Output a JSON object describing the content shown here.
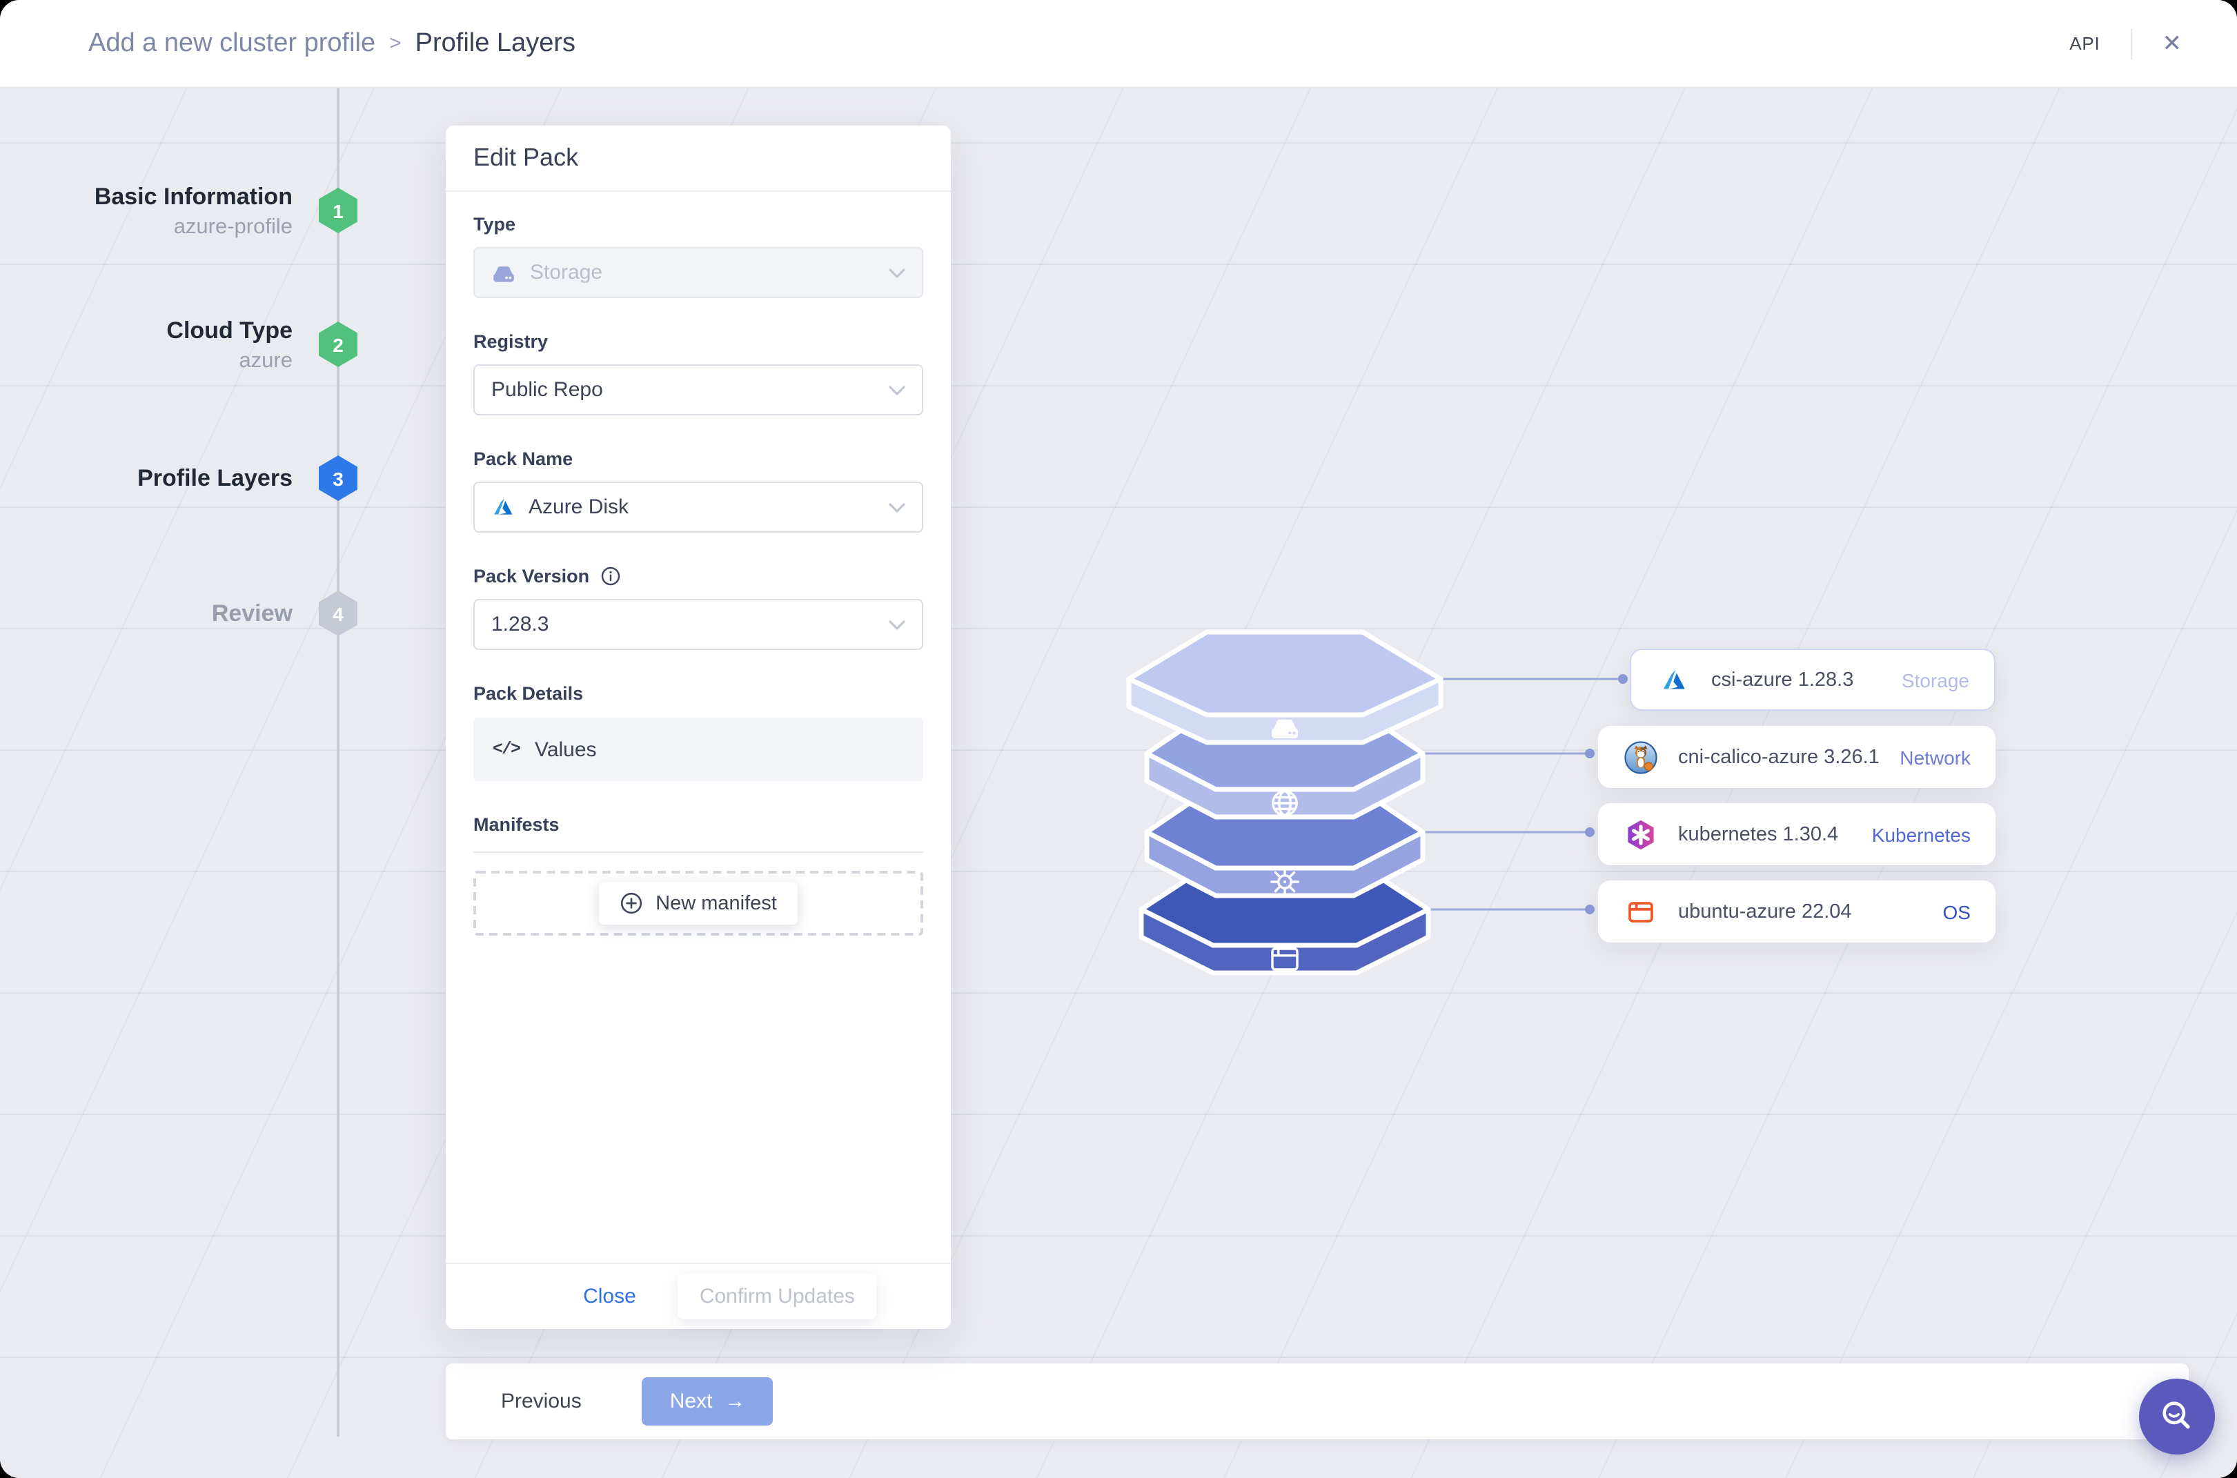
{
  "header": {
    "breadcrumb": {
      "parent": "Add a new cluster profile",
      "separator": ">",
      "current": "Profile Layers"
    },
    "api_label": "API",
    "close_icon": "✕"
  },
  "stepper": {
    "steps": [
      {
        "num": "1",
        "title": "Basic Information",
        "subtitle": "azure-profile",
        "state": "done"
      },
      {
        "num": "2",
        "title": "Cloud Type",
        "subtitle": "azure",
        "state": "done"
      },
      {
        "num": "3",
        "title": "Profile Layers",
        "subtitle": "",
        "state": "active"
      },
      {
        "num": "4",
        "title": "Review",
        "subtitle": "",
        "state": "upcoming"
      }
    ],
    "badge_colors": {
      "done": "#53c17e",
      "active": "#2d79ea",
      "upcoming": "#c5c9d5"
    }
  },
  "edit_pack": {
    "title": "Edit Pack",
    "type": {
      "label": "Type",
      "value": "Storage",
      "disabled": true
    },
    "registry": {
      "label": "Registry",
      "value": "Public Repo"
    },
    "pack_name": {
      "label": "Pack Name",
      "value": "Azure Disk"
    },
    "pack_version": {
      "label": "Pack Version",
      "value": "1.28.3"
    },
    "pack_details": {
      "label": "Pack Details",
      "value": "Values",
      "code_glyph": "</>"
    },
    "manifests": {
      "label": "Manifests",
      "new_button_label": "New manifest"
    },
    "footer": {
      "close_label": "Close",
      "confirm_label": "Confirm Updates"
    }
  },
  "profile_layers": {
    "cards": [
      {
        "name": "csi-azure 1.28.3",
        "category": "Storage",
        "icon": "azure-icon",
        "category_color": "#b3bbe4",
        "selected": true
      },
      {
        "name": "cni-calico-azure 3.26.1",
        "category": "Network",
        "icon": "calico-icon",
        "category_color": "#6c7ad8",
        "selected": false
      },
      {
        "name": "kubernetes 1.30.4",
        "category": "Kubernetes",
        "icon": "kubernetes-icon",
        "category_color": "#4f68d5",
        "selected": false
      },
      {
        "name": "ubuntu-azure 22.04",
        "category": "OS",
        "icon": "ubuntu-icon",
        "category_color": "#2f51c2",
        "selected": false
      }
    ],
    "stack": {
      "layers": [
        {
          "icon": "storage-drive-icon",
          "top_color": "#bfc8ef",
          "side_color": "#d4d9f4"
        },
        {
          "icon": "globe-icon",
          "top_color": "#93a2e0",
          "side_color": "#b2bce9"
        },
        {
          "icon": "kubernetes-helm-icon",
          "top_color": "#6e81d3",
          "side_color": "#97a3e0"
        },
        {
          "icon": "os-window-icon",
          "top_color": "#3f57b6",
          "side_color": "#5064c0"
        }
      ]
    }
  },
  "bottom_bar": {
    "previous_label": "Previous",
    "next_label": "Next",
    "next_arrow": "→"
  }
}
